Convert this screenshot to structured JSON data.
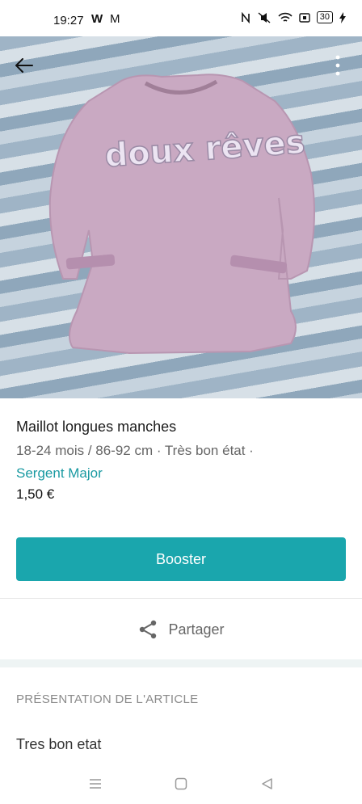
{
  "status_bar": {
    "time": "19:27",
    "app_icon_1": "W",
    "app_icon_2": "M",
    "battery": "30"
  },
  "photo": {
    "subject": "tshirt-photo",
    "shirt_text": "doux rêves",
    "colors": {
      "shirt": "#c9a9c2",
      "stripe_light": "#d7e0e7",
      "stripe_dark": "#8fa7bb"
    }
  },
  "item": {
    "title": "Maillot longues manches",
    "meta": "18-24 mois / 86-92 cm · Très bon état · ",
    "brand": "Sergent Major",
    "price": "1,50 €"
  },
  "actions": {
    "booster_label": "Booster",
    "share_label": "Partager"
  },
  "section": {
    "title": "PRÉSENTATION DE L'ARTICLE",
    "description": "Tres bon etat"
  },
  "colors": {
    "accent": "#1aa6ad",
    "brand_text": "#1a9aa2"
  }
}
